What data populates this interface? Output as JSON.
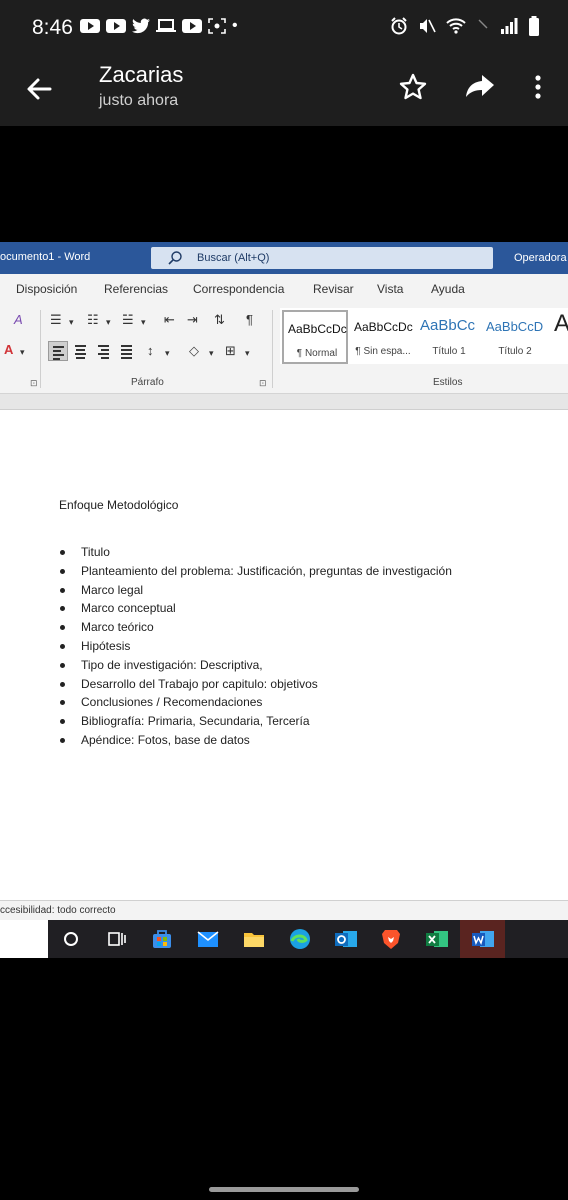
{
  "status_bar": {
    "time": "8:46"
  },
  "app_bar": {
    "sender": "Zacarias",
    "subtitle": "justo ahora"
  },
  "word": {
    "document_title": "ocumento1  -  Word",
    "search_placeholder": "Buscar (Alt+Q)",
    "user": "Operadora",
    "tabs": [
      "Disposición",
      "Referencias",
      "Correspondencia",
      "Revisar",
      "Vista",
      "Ayuda"
    ],
    "group_labels": {
      "paragraph": "Párrafo",
      "styles": "Estilos"
    },
    "styles": [
      {
        "preview": "AaBbCcDc",
        "name": "¶ Normal"
      },
      {
        "preview": "AaBbCcDc",
        "name": "¶ Sin espa..."
      },
      {
        "preview": "AaBbCc",
        "name": "Título 1"
      },
      {
        "preview": "AaBbCcD",
        "name": "Título 2"
      }
    ],
    "document": {
      "heading": "Enfoque Metodológico",
      "bullets": [
        "Titulo",
        "Planteamiento del problema: Justificación, preguntas de investigación",
        "Marco legal",
        "Marco conceptual",
        "Marco teórico",
        "Hipótesis",
        "Tipo de investigación: Descriptiva,",
        "Desarrollo del Trabajo por capitulo: objetivos",
        "Conclusiones / Recomendaciones",
        "Bibliografía: Primaria, Secundaria, Tercería",
        "Apéndice: Fotos, base de datos"
      ]
    },
    "status": "ccesibilidad: todo correcto"
  },
  "taskbar_icons": [
    "search-icon",
    "task-view-icon",
    "store-icon",
    "mail-icon",
    "file-explorer-icon",
    "edge-icon",
    "outlook-icon",
    "brave-icon",
    "excel-icon",
    "word-icon"
  ],
  "colors": {
    "word_blue": "#2b579a",
    "taskbar": "#201f23",
    "app_bar": "#1e1e1e"
  }
}
